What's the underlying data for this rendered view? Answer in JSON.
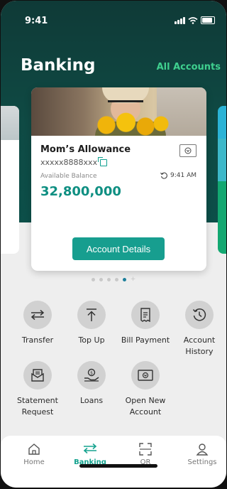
{
  "status_bar": {
    "time": "9:41"
  },
  "header": {
    "title": "Banking",
    "all_accounts": "All Accounts"
  },
  "account_card": {
    "name": "Mom’s Allowance",
    "number": "xxxxx8888xxx",
    "balance_label": "Available Balance",
    "refresh_time": "9:41 AM",
    "balance": "32,800,000",
    "details_button": "Account Details"
  },
  "pager": {
    "count": 5,
    "active_index": 3
  },
  "actions": [
    {
      "label": "Transfer",
      "icon": "transfer-arrows-icon"
    },
    {
      "label": "Top Up",
      "icon": "top-up-icon"
    },
    {
      "label": "Bill Payment",
      "icon": "bill-icon"
    },
    {
      "label": "Account History",
      "icon": "history-icon"
    },
    {
      "label": "Statement Request",
      "icon": "statement-icon"
    },
    {
      "label": "Loans",
      "icon": "loans-icon"
    },
    {
      "label": "Open New Account",
      "icon": "new-account-icon"
    }
  ],
  "tabs": [
    {
      "label": "Home",
      "icon": "home-icon"
    },
    {
      "label": "Banking",
      "icon": "banking-icon"
    },
    {
      "label": "QR",
      "icon": "qr-scan-icon"
    },
    {
      "label": "Settings",
      "icon": "person-icon"
    }
  ],
  "colors": {
    "accent": "#179e8f",
    "header_bg": "#0f4a44",
    "link": "#3fd08f"
  }
}
